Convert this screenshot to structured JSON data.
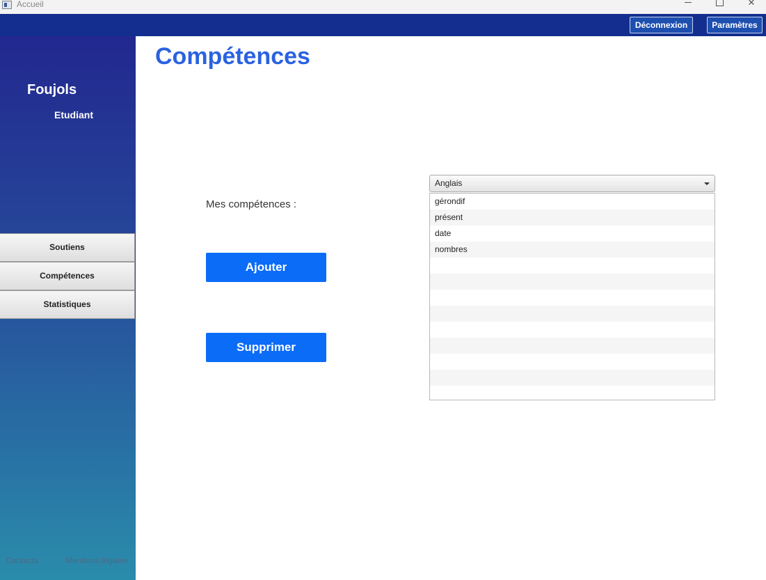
{
  "window": {
    "title": "Accueil"
  },
  "topbar": {
    "logout_label": "Déconnexion",
    "settings_label": "Paramètres"
  },
  "sidebar": {
    "user_name": "Foujols",
    "user_role": "Etudiant",
    "nav": [
      {
        "label": "Soutiens"
      },
      {
        "label": "Compétences"
      },
      {
        "label": "Statistiques"
      }
    ],
    "footer": {
      "contacts": "Contacts",
      "mentions": "Mentions légales"
    }
  },
  "main": {
    "title": "Compétences",
    "skills_label": "Mes compétences :",
    "add_label": "Ajouter",
    "delete_label": "Supprimer",
    "subject_select": {
      "selected": "Anglais"
    },
    "skills": [
      "gérondif",
      "présent",
      "date",
      "nombres"
    ]
  }
}
